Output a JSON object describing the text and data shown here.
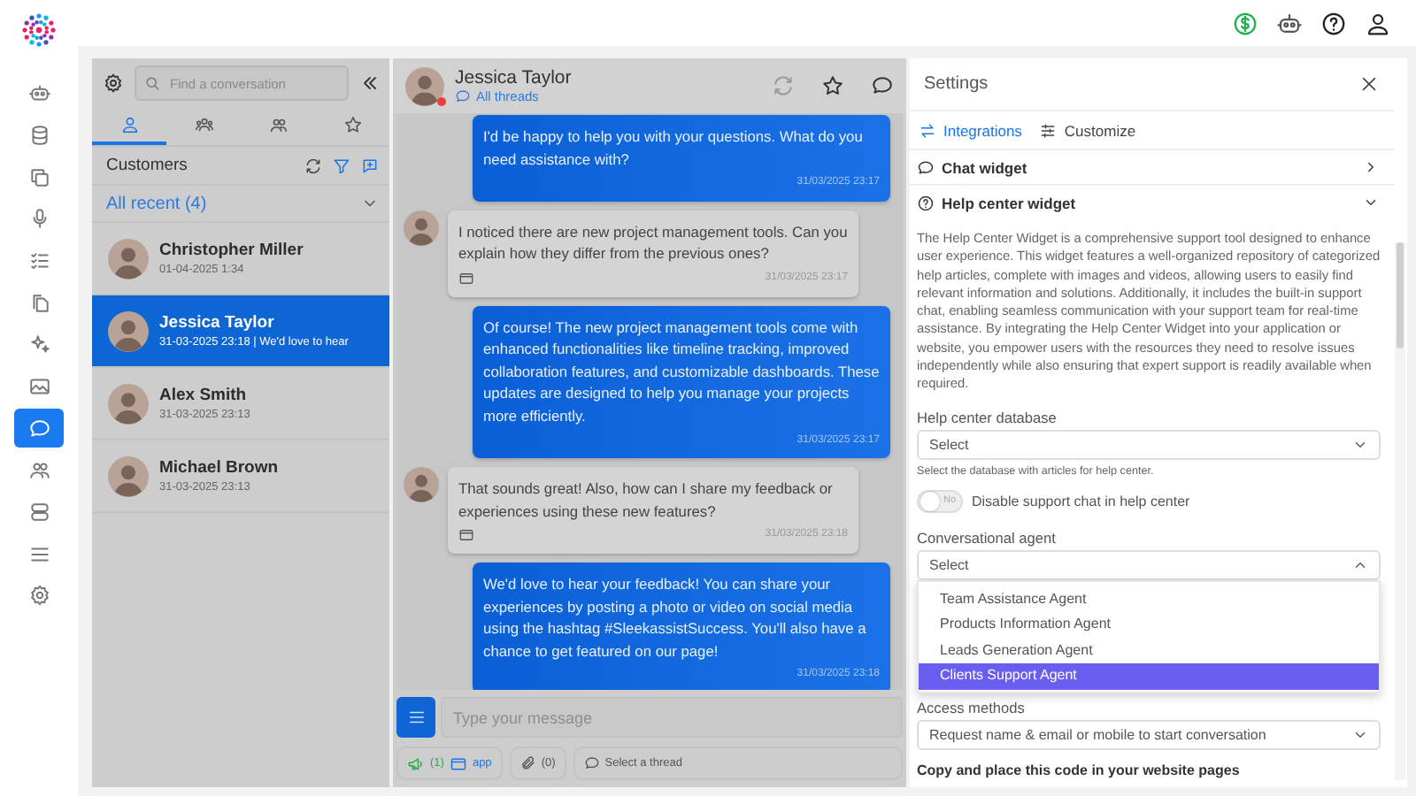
{
  "rail": {
    "items": [
      {
        "kind": "bot",
        "selected": false
      },
      {
        "kind": "database",
        "selected": false
      },
      {
        "kind": "copy",
        "selected": false
      },
      {
        "kind": "mic",
        "selected": false
      },
      {
        "kind": "checklist",
        "selected": false
      },
      {
        "kind": "files",
        "selected": false
      },
      {
        "kind": "sparkle",
        "selected": false
      },
      {
        "kind": "image",
        "selected": false
      },
      {
        "kind": "chat",
        "selected": true
      },
      {
        "kind": "users",
        "selected": false
      },
      {
        "kind": "server",
        "selected": false
      },
      {
        "kind": "menu",
        "selected": false
      },
      {
        "kind": "gear",
        "selected": false
      }
    ]
  },
  "conversations": {
    "search": {
      "placeholder": "Find a conversation"
    },
    "tabs": [
      {
        "kind": "user",
        "selected": true
      },
      {
        "kind": "group",
        "selected": false
      },
      {
        "kind": "users",
        "selected": false
      },
      {
        "kind": "star",
        "selected": false
      }
    ],
    "title": "Customers",
    "filter": "All recent (4)",
    "items": [
      {
        "name": "Christopher Miller",
        "meta": "01-04-2025 1:34",
        "selected": false
      },
      {
        "name": "Jessica Taylor",
        "meta": "31-03-2025 23:18 | We'd love to hear",
        "selected": true
      },
      {
        "name": "Alex Smith",
        "meta": "31-03-2025 23:13",
        "selected": false
      },
      {
        "name": "Michael Brown",
        "meta": "31-03-2025 23:13",
        "selected": false
      }
    ]
  },
  "chat": {
    "contact": "Jessica Taylor",
    "threads_link": "All threads",
    "messages": [
      {
        "kind": "agent",
        "text": "I'd be happy to help you with your questions. What do you need assistance with?",
        "time": "31/03/2025 23:17"
      },
      {
        "kind": "customer",
        "text": "I noticed there are new project management tools. Can you explain how they differ from the previous ones?",
        "time": "31/03/2025 23:17"
      },
      {
        "kind": "agent",
        "text": "Of course! The new project management tools come with enhanced functionalities like timeline tracking, improved collaboration features, and customizable dashboards. These updates are designed to help you manage your projects more efficiently.",
        "time": "31/03/2025 23:17"
      },
      {
        "kind": "customer",
        "text": "That sounds great! Also, how can I share my feedback or experiences using these new features?",
        "time": "31/03/2025 23:18"
      },
      {
        "kind": "agent",
        "text": "We'd love to hear your feedback! You can share your experiences by posting a photo or video on social media using the hashtag #SleekassistSuccess. You'll also have a chance to get featured on our page!",
        "time": "31/03/2025 23:18"
      }
    ],
    "composer": {
      "placeholder": "Type your message"
    },
    "footer": {
      "channel_count": "(1)",
      "channel": "app",
      "attachments": "(0)",
      "thread": "Select a thread"
    }
  },
  "settings": {
    "title": "Settings",
    "tabs": [
      {
        "label": "Integrations",
        "selected": true
      },
      {
        "label": "Customize",
        "selected": false
      }
    ],
    "sections": [
      {
        "title": "Chat widget",
        "expanded": false
      },
      {
        "title": "Help center widget",
        "expanded": true
      }
    ],
    "description": "The Help Center Widget is a comprehensive support tool designed to enhance user experience. This widget features a well-organized repository of categorized help articles, complete with images and videos, allowing users to easily find relevant information and solutions. Additionally, it includes the built-in support chat, enabling seamless communication with your support team for real-time assistance. By integrating the Help Center Widget into your application or website, you empower users with the resources they need to resolve issues independently while also ensuring that expert support is readily available when required.",
    "database": {
      "label": "Help center database",
      "value": "Select",
      "hint": "Select the database with articles for help center."
    },
    "toggle": {
      "on": false,
      "state_label": "No",
      "label": "Disable support chat in help center"
    },
    "agent": {
      "label": "Conversational agent",
      "value": "Select",
      "open": true,
      "options": [
        {
          "label": "Team Assistance Agent",
          "selected": false
        },
        {
          "label": "Products Information Agent",
          "selected": false
        },
        {
          "label": "Leads Generation Agent",
          "selected": false
        },
        {
          "label": "Clients Support Agent",
          "selected": true
        }
      ]
    },
    "access": {
      "label": "Access methods",
      "value": "Request name & email or mobile to start conversation"
    },
    "code_heading": "Copy and place this code in your website pages"
  }
}
